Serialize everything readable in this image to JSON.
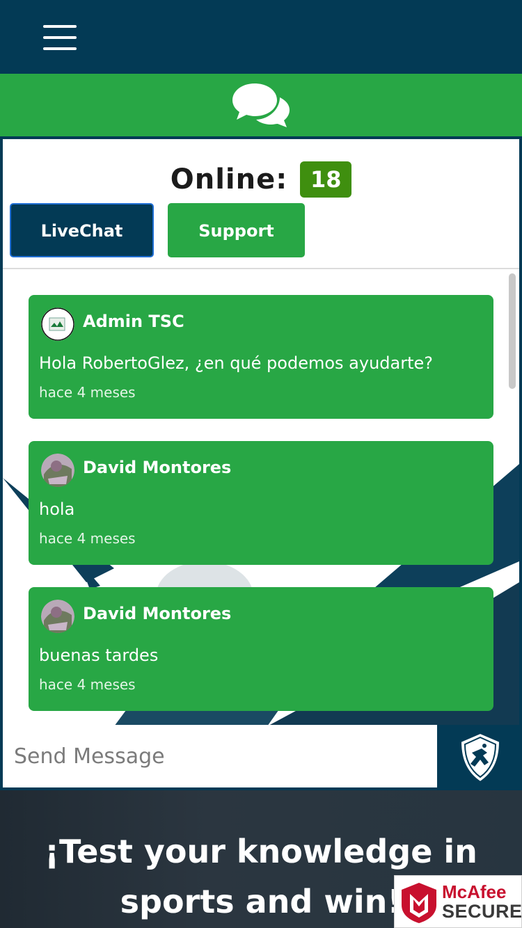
{
  "header": {
    "menu_icon": "hamburger-icon",
    "chat_icon": "comments-icon"
  },
  "online": {
    "label": "Online:",
    "count": "18"
  },
  "tabs": [
    {
      "label": "LiveChat",
      "active": true
    },
    {
      "label": "Support",
      "active": false
    }
  ],
  "messages": [
    {
      "author": "Admin TSC",
      "text": "Hola RobertoGlez, ¿en qué podemos ayudarte?",
      "time": "hace 4 meses"
    },
    {
      "author": "David Montores",
      "text": "hola",
      "time": "hace 4 meses"
    },
    {
      "author": "David Montores",
      "text": "buenas tardes",
      "time": "hace 4 meses"
    }
  ],
  "composer": {
    "placeholder": "Send Message",
    "send_icon": "shield-logo-send-icon"
  },
  "banner": {
    "line1": "¡Test your knowledge in",
    "line2": "sports and win!"
  },
  "badge": {
    "brand": "McAfee",
    "label": "SECURE"
  },
  "colors": {
    "navy": "#033a55",
    "green": "#28a745",
    "online_badge": "#3f8f0f",
    "mcafee_red": "#c8102e"
  }
}
